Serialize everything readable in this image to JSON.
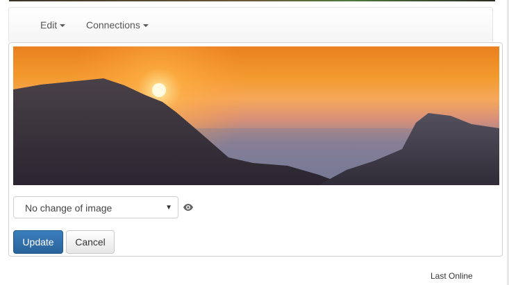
{
  "navbar": {
    "items": [
      {
        "label": "Edit"
      },
      {
        "label": "Connections"
      }
    ]
  },
  "image_select": {
    "selected": "No change of image"
  },
  "buttons": {
    "update": "Update",
    "cancel": "Cancel"
  },
  "footer": {
    "last_online": "Last Online"
  },
  "colors": {
    "primary": "#2a639b",
    "sky_top": "#e9801f",
    "sun": "#fff6c8"
  },
  "icons": {
    "nav_caret": "caret-down-icon",
    "select_arrow": "triangle-down-icon",
    "preview": "eye-icon"
  }
}
